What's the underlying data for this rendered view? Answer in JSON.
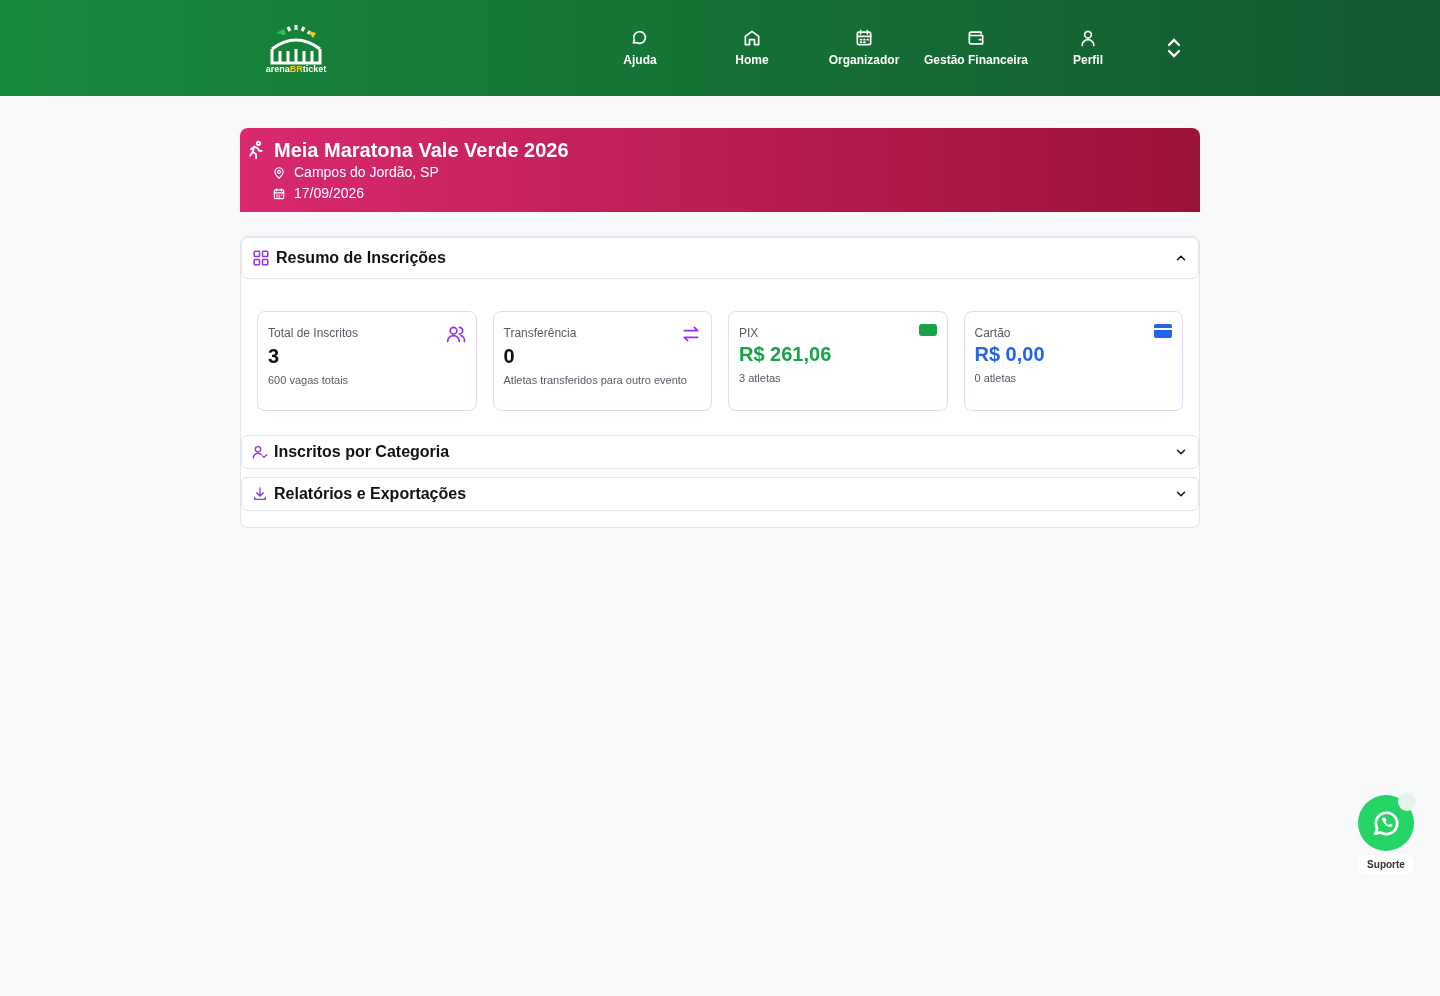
{
  "logo": {
    "parts": [
      "arena",
      "BR",
      "ticket"
    ]
  },
  "nav": [
    {
      "label": "Ajuda",
      "kind": "chat"
    },
    {
      "label": "Home",
      "kind": "home"
    },
    {
      "label": "Organizador",
      "kind": "calendar"
    },
    {
      "label": "Gestão Financeira",
      "kind": "wallet"
    },
    {
      "label": "Perfil",
      "kind": "user"
    }
  ],
  "event": {
    "title": "Meia Maratona Vale Verde 2026",
    "location": "Campos do Jordão, SP",
    "date": "17/09/2026"
  },
  "sections": [
    {
      "title": "Resumo de Inscrições",
      "kind": "grid",
      "expanded": true,
      "stats": [
        {
          "label": "Total de Inscritos",
          "value": "3",
          "note": "600 vagas totais",
          "kind": "users",
          "color": "#111111"
        },
        {
          "label": "Transferência",
          "value": "0",
          "note": "Atletas transferidos para outro evento",
          "kind": "transfer",
          "color": "#111111"
        },
        {
          "label": "PIX",
          "value": "R$ 261,06",
          "note": "3 atletas",
          "kind": "cash",
          "color": "#16a34a"
        },
        {
          "label": "Cartão",
          "value": "R$ 0,00",
          "note": "0 atletas",
          "kind": "card",
          "color": "#2563eb"
        }
      ]
    },
    {
      "title": "Inscritos por Categoria",
      "kind": "usercheck",
      "expanded": false
    },
    {
      "title": "Relatórios e Exportações",
      "kind": "download",
      "expanded": false
    }
  ],
  "support": {
    "label": "Suporte"
  }
}
